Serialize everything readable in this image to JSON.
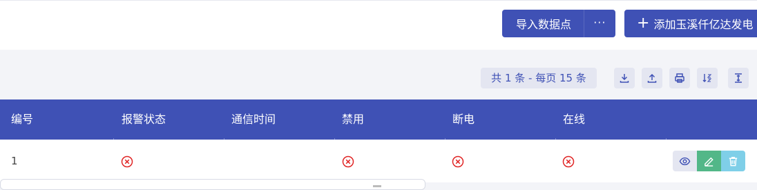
{
  "header": {
    "import_label": "导入数据点",
    "more_label": "···",
    "add_label": "添加玉溪仟亿达发电"
  },
  "toolbar": {
    "count_text": "共 1 条 - 每页 15 条",
    "icons": [
      "download-icon",
      "upload-icon",
      "print-icon",
      "sort-icon",
      "column-height-icon"
    ]
  },
  "table": {
    "columns": [
      "编号",
      "报警状态",
      "通信时间",
      "禁用",
      "断电",
      "在线"
    ],
    "rows": [
      {
        "id": "1",
        "alarm_status": "error",
        "comm_time": "",
        "disabled": "error",
        "power_off": "error",
        "online": "error"
      }
    ]
  },
  "colors": {
    "primary": "#3f51b5",
    "error": "#e02424",
    "edit": "#52b788",
    "delete": "#7fcfe8",
    "light": "#e4e6f1"
  }
}
